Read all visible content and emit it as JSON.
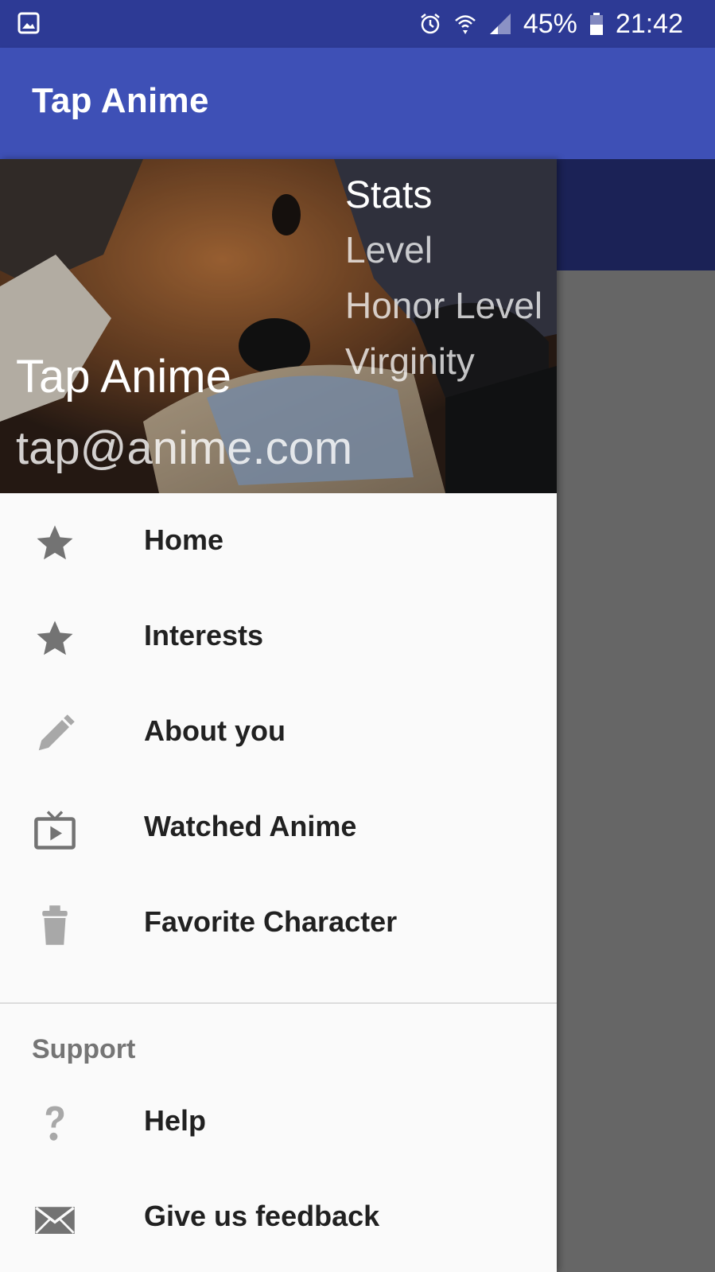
{
  "status_bar": {
    "battery": "45%",
    "time": "21:42"
  },
  "app_bar": {
    "title": "Tap Anime"
  },
  "drawer": {
    "header": {
      "name": "Tap Anime",
      "email": "tap@anime.com",
      "stats_title": "Stats",
      "stats": [
        "Level",
        "Honor Level",
        "Virginity"
      ]
    },
    "menu": [
      {
        "label": "Home",
        "icon": "star-icon"
      },
      {
        "label": "Interests",
        "icon": "star-icon"
      },
      {
        "label": "About you",
        "icon": "pencil-icon"
      },
      {
        "label": "Watched Anime",
        "icon": "tv-play-icon"
      },
      {
        "label": "Favorite Character",
        "icon": "trash-icon"
      }
    ],
    "support_section": {
      "title": "Support",
      "items": [
        {
          "label": "Help",
          "icon": "help-icon"
        },
        {
          "label": "Give us feedback",
          "icon": "mail-icon"
        }
      ]
    }
  },
  "colors": {
    "status_bar": "#2d3a95",
    "app_bar": "#3e50b6",
    "drawer_bg": "#fafafa",
    "scrim": "#666666"
  }
}
